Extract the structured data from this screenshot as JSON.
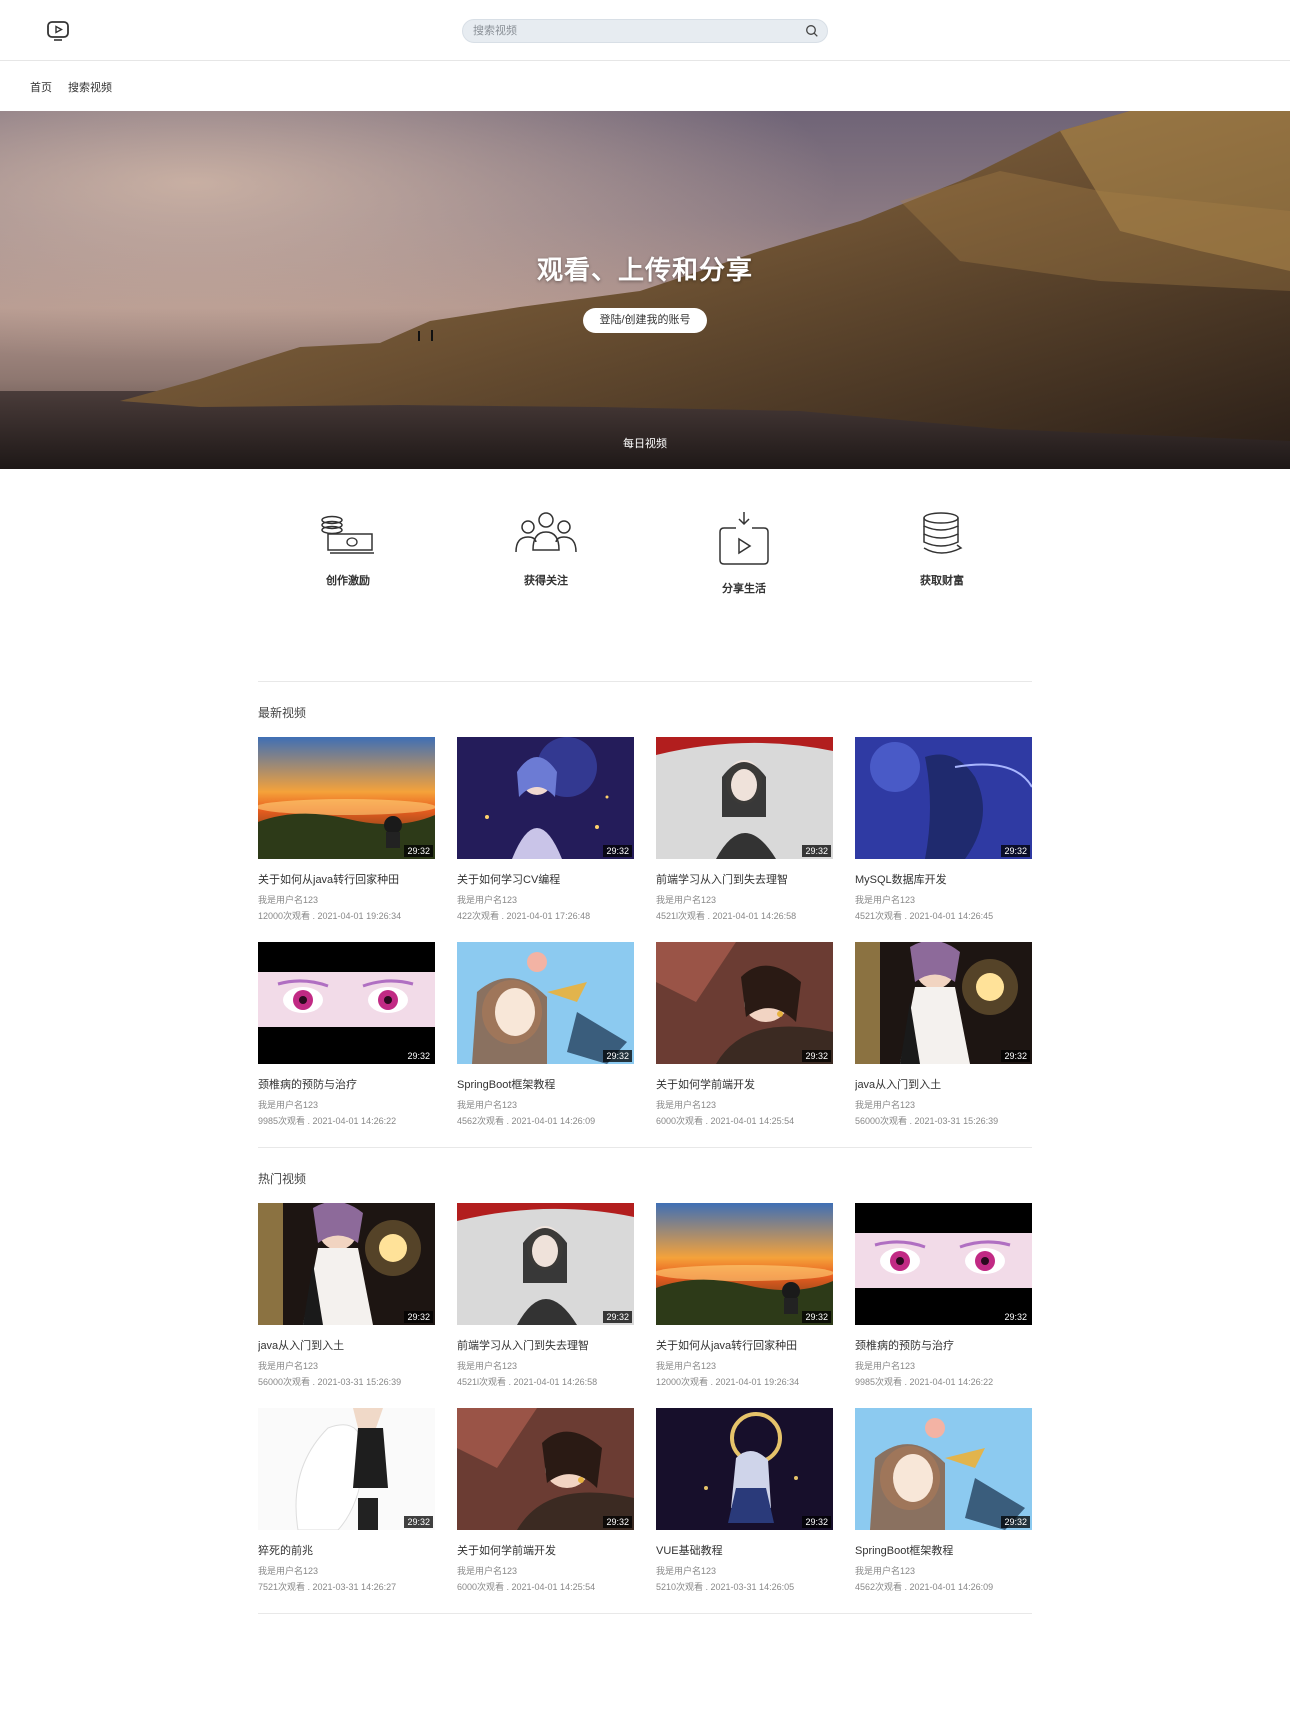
{
  "header": {
    "logo_icon": "play-screen-icon",
    "search_placeholder": "搜索视频",
    "search_icon": "search-icon"
  },
  "breadcrumb": {
    "home": "首页",
    "search": "搜索视频"
  },
  "hero": {
    "title": "观看、上传和分享",
    "button": "登陆/创建我的账号",
    "subtitle": "每日视频"
  },
  "features": [
    {
      "label": "创作激励",
      "icon": "cash-coins-icon"
    },
    {
      "label": "获得关注",
      "icon": "people-group-icon"
    },
    {
      "label": "分享生活",
      "icon": "video-download-icon"
    },
    {
      "label": "获取财富",
      "icon": "coin-stack-icon"
    }
  ],
  "latest": {
    "title": "最新视频",
    "videos": [
      {
        "title": "关于如何从java转行回家种田",
        "user": "我是用户名123",
        "meta": "12000次观看 . 2021-04-01 19:26:34",
        "duration": "29:32",
        "scene": "sunset"
      },
      {
        "title": "关于如何学习CV编程",
        "user": "我是用户名123",
        "meta": "422次观看 . 2021-04-01 17:26:48",
        "duration": "29:32",
        "scene": "night-girl"
      },
      {
        "title": "前端学习从入门到失去理智",
        "user": "我是用户名123",
        "meta": "4521l次观看 . 2021-04-01 14:26:58",
        "duration": "29:32",
        "scene": "umbrella"
      },
      {
        "title": "MySQL数据库开发",
        "user": "我是用户名123",
        "meta": "4521次观看 . 2021-04-01 14:26:45",
        "duration": "29:32",
        "scene": "blue-wind"
      },
      {
        "title": "颈椎病的预防与治疗",
        "user": "我是用户名123",
        "meta": "9985次观看 . 2021-04-01 14:26:22",
        "duration": "29:32",
        "scene": "eyes"
      },
      {
        "title": "SpringBoot框架教程",
        "user": "我是用户名123",
        "meta": "4562次观看 . 2021-04-01 14:26:09",
        "duration": "29:32",
        "scene": "sky-girl"
      },
      {
        "title": "关于如何学前端开发",
        "user": "我是用户名123",
        "meta": "6000次观看 . 2021-04-01 14:25:54",
        "duration": "29:32",
        "scene": "sleeping"
      },
      {
        "title": "java从入门到入土",
        "user": "我是用户名123",
        "meta": "56000次观看 . 2021-03-31 15:26:39",
        "duration": "29:32",
        "scene": "lamp"
      }
    ]
  },
  "hot": {
    "title": "热门视频",
    "videos": [
      {
        "title": "java从入门到入土",
        "user": "我是用户名123",
        "meta": "56000次观看 . 2021-03-31 15:26:39",
        "duration": "29:32",
        "scene": "lamp"
      },
      {
        "title": "前端学习从入门到失去理智",
        "user": "我是用户名123",
        "meta": "4521l次观看 . 2021-04-01 14:26:58",
        "duration": "29:32",
        "scene": "umbrella"
      },
      {
        "title": "关于如何从java转行回家种田",
        "user": "我是用户名123",
        "meta": "12000次观看 . 2021-04-01 19:26:34",
        "duration": "29:32",
        "scene": "sunset"
      },
      {
        "title": "颈椎病的预防与治疗",
        "user": "我是用户名123",
        "meta": "9985次观看 . 2021-04-01 14:26:22",
        "duration": "29:32",
        "scene": "eyes"
      },
      {
        "title": "猝死的前兆",
        "user": "我是用户名123",
        "meta": "7521次观看 . 2021-03-31 14:26:27",
        "duration": "29:32",
        "scene": "white-cat"
      },
      {
        "title": "关于如何学前端开发",
        "user": "我是用户名123",
        "meta": "6000次观看 . 2021-04-01 14:25:54",
        "duration": "29:32",
        "scene": "sleeping"
      },
      {
        "title": "VUE基础教程",
        "user": "我是用户名123",
        "meta": "5210次观看 . 2021-03-31 14:26:05",
        "duration": "29:32",
        "scene": "moon"
      },
      {
        "title": "SpringBoot框架教程",
        "user": "我是用户名123",
        "meta": "4562次观看 . 2021-04-01 14:26:09",
        "duration": "29:32",
        "scene": "sky-girl"
      }
    ]
  }
}
